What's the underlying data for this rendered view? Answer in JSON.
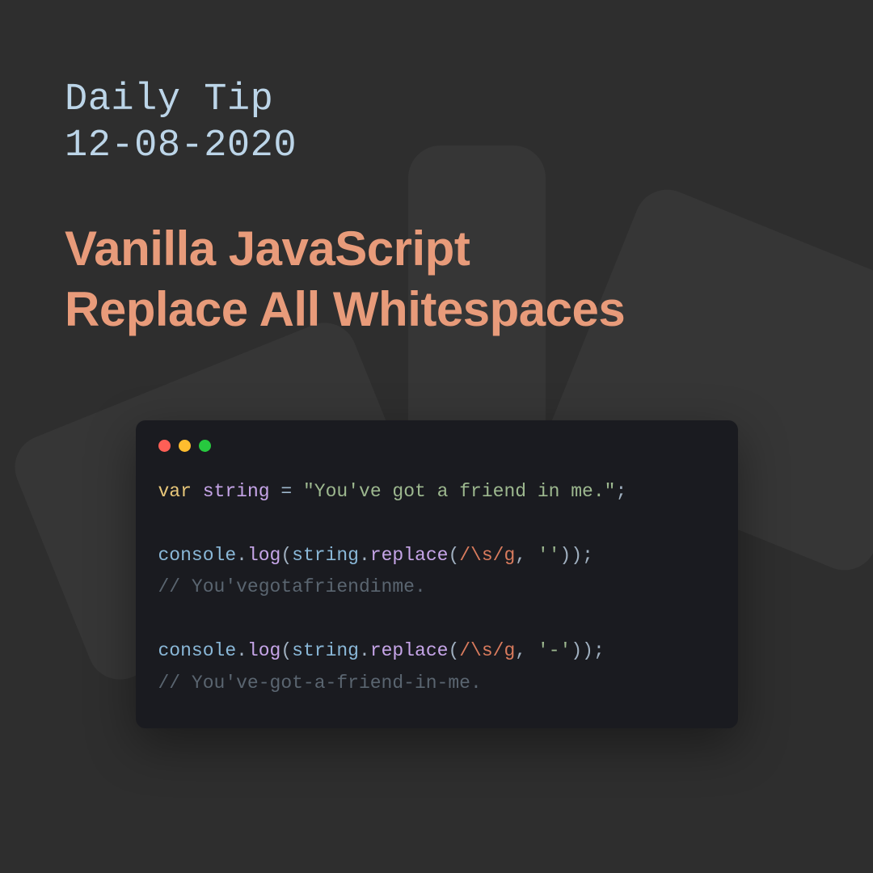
{
  "header": {
    "label": "Daily Tip",
    "date": "12-08-2020"
  },
  "title": {
    "line1": "Vanilla JavaScript",
    "line2": "Replace All Whitespaces"
  },
  "code": {
    "kw_var": "var",
    "var_name": "string",
    "op_eq": "=",
    "string_literal": "\"You've got a friend in me.\"",
    "semi": ";",
    "console": "console",
    "dot": ".",
    "log": "log",
    "open": "(",
    "close": ")",
    "string_ref": "string",
    "replace": "replace",
    "regex": "/\\s/g",
    "comma": ",",
    "empty_str": "''",
    "dash_str": "'-'",
    "comment1": "// You'vegotafriendinme.",
    "comment2": "// You've-got-a-friend-in-me."
  }
}
